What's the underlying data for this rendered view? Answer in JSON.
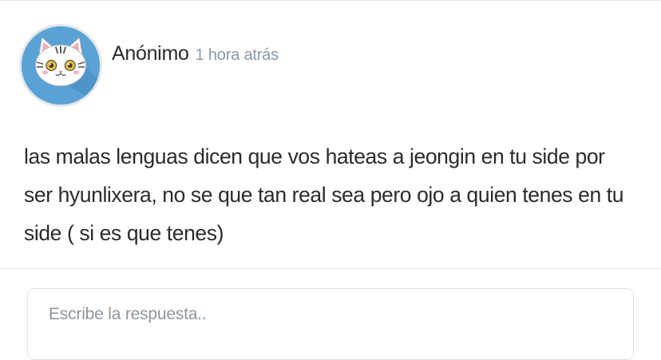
{
  "post": {
    "author": "Anónimo",
    "time": "1 hora atrás",
    "avatar_icon": "cat-face-icon",
    "message": "las malas lenguas dicen que vos hateas a jeongin en tu side por ser hyunlixera, no se que tan real sea pero ojo a quien tenes en tu side ( si es que tenes)"
  },
  "reply": {
    "placeholder": "Escribe la respuesta..",
    "value": ""
  },
  "colors": {
    "avatar_bg": "#5aa2d6",
    "time_text": "#8a9aa8",
    "body_text": "#2b2b2b",
    "border": "#e3e6e9"
  }
}
